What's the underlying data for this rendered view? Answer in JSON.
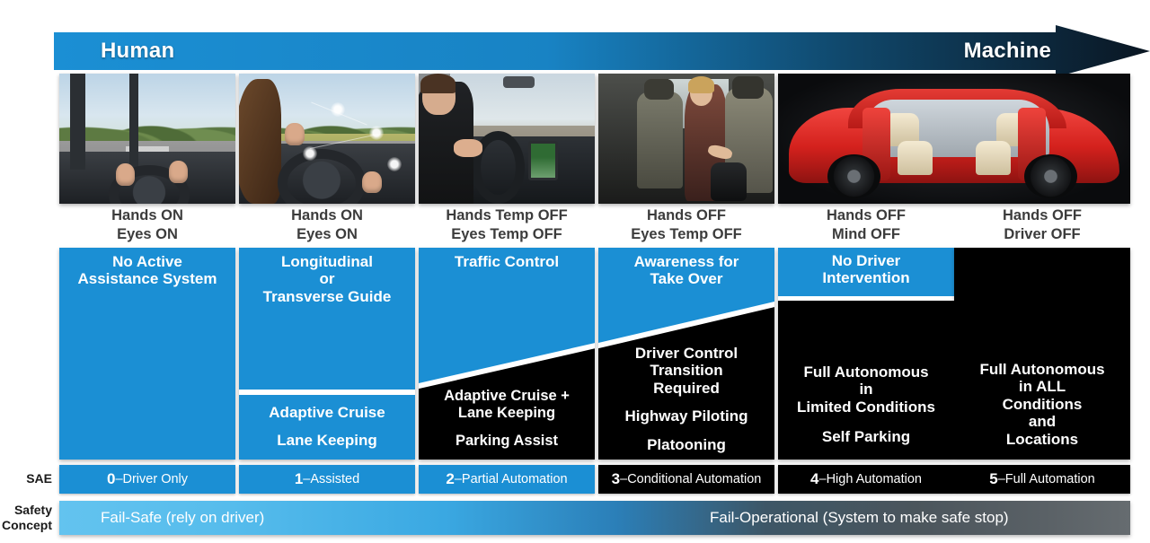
{
  "banner": {
    "left_label": "Human",
    "right_label": "Machine",
    "gradient_from": "#1b8fd4",
    "gradient_to": "#0a1622"
  },
  "columns": [
    {
      "photo_alt": "driver-hands-on-wheel-road-view",
      "caption_line1": "Hands ON",
      "caption_line2": "Eyes ON",
      "block_style": "solid-blue",
      "top_text": [
        "No Active",
        "Assistance System"
      ],
      "bottom_text": [],
      "sae_level": "0",
      "sae_name": "–Driver Only",
      "sae_color": "#1b8fd4"
    },
    {
      "photo_alt": "woman-driving-with-ar-overlay",
      "caption_line1": "Hands ON",
      "caption_line2": "Eyes ON",
      "block_style": "split-horizontal",
      "top_text": [
        "Longitudinal",
        "or",
        "Transverse Guide"
      ],
      "bottom_text": [
        "Adaptive Cruise",
        "Lane Keeping"
      ],
      "sae_level": "1",
      "sae_name": "–Assisted",
      "sae_color": "#1b8fd4"
    },
    {
      "photo_alt": "man-hands-off-wheel-infotainment",
      "caption_line1": "Hands Temp OFF",
      "caption_line2": "Eyes Temp OFF",
      "block_style": "split-diagonal",
      "top_text": [
        "Traffic Control"
      ],
      "bottom_text": [
        "Adaptive Cruise +",
        "Lane Keeping",
        "Parking Assist"
      ],
      "sae_level": "2",
      "sae_name": "–Partial Automation",
      "sae_color": "#1b8fd4"
    },
    {
      "photo_alt": "woman-reaching-back-for-bag",
      "caption_line1": "Hands OFF",
      "caption_line2": "Eyes Temp OFF",
      "block_style": "split-diagonal",
      "top_text": [
        "Awareness for",
        "Take Over"
      ],
      "bottom_text": [
        "Driver Control",
        "Transition",
        "Required",
        "Highway Piloting",
        "Platooning"
      ],
      "sae_level": "3",
      "sae_name": "–Conditional Automation",
      "sae_color": "#000000"
    },
    {
      "photo_alt": "red-autonomous-concept-car",
      "caption_line1": "Hands OFF",
      "caption_line2": "Mind OFF",
      "block_style": "split-horizontal-black",
      "top_text": [
        "No Driver",
        "Intervention"
      ],
      "bottom_text": [
        "Full Autonomous",
        "in",
        "Limited Conditions",
        "Self Parking"
      ],
      "sae_level": "4",
      "sae_name": "–High Automation",
      "sae_color": "#000000"
    },
    {
      "photo_alt": "red-autonomous-concept-car",
      "caption_line1": "Hands OFF",
      "caption_line2": "Driver OFF",
      "block_style": "solid-black",
      "top_text": [],
      "bottom_text": [
        "Full Autonomous",
        "in ALL",
        "Conditions",
        "and",
        "Locations"
      ],
      "sae_level": "5",
      "sae_name": "–Full Automation",
      "sae_color": "#000000"
    }
  ],
  "rows": {
    "sae_label": "SAE",
    "safety_label_line1": "Safety",
    "safety_label_line2": "Concept"
  },
  "safety": {
    "left_text": "Fail-Safe (rely on driver)",
    "right_text": "Fail-Operational (System to make safe stop)"
  },
  "palette": {
    "blue": "#1b8fd4",
    "black": "#000000",
    "white": "#ffffff",
    "caption_text": "#3c3c3c"
  }
}
